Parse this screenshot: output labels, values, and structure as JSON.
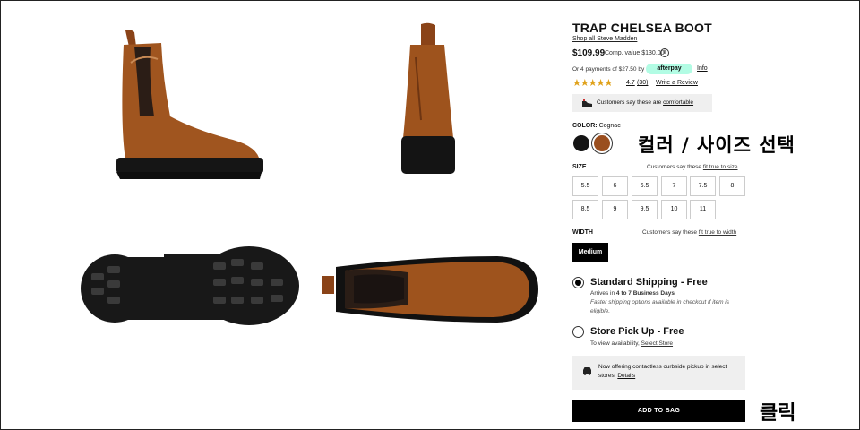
{
  "product": {
    "title": "TRAP CHELSEA BOOT",
    "shop_link": "Shop all Steve Madden",
    "price": "$109.99",
    "comp_value": "Comp. value $130.00",
    "payments_text": "Or 4 payments of $27.50 by",
    "afterpay_label": "afterpay",
    "info_link": "Info",
    "stars": "★★★★★",
    "rating": "4.7",
    "review_count": "(30)",
    "write_review": "Write a Review",
    "comfort_prefix": "Customers say these are ",
    "comfort_link": "comfortable"
  },
  "color": {
    "label": "COLOR:",
    "selected": "Cognac",
    "swatches": [
      {
        "name": "Black",
        "hex": "#141414"
      },
      {
        "name": "Cognac",
        "hex": "#9a4e1e"
      }
    ]
  },
  "size": {
    "label": "SIZE",
    "note_prefix": "Customers say these ",
    "note_link": "fit true to size",
    "options": [
      "5.5",
      "6",
      "6.5",
      "7",
      "7.5",
      "8",
      "8.5",
      "9",
      "9.5",
      "10",
      "11"
    ]
  },
  "width": {
    "label": "WIDTH",
    "note_prefix": "Customers say these ",
    "note_link": "fit true to width",
    "selected": "Medium"
  },
  "shipping": {
    "standard_title": "Standard Shipping - Free",
    "standard_sub_prefix": "Arrives in ",
    "standard_sub_bold": "4 to 7 Business Days",
    "standard_note": "Faster shipping options available in checkout if item is eligible.",
    "pickup_title": "Store Pick Up - Free",
    "pickup_sub_prefix": "To view availability, ",
    "pickup_link": "Select Store"
  },
  "curbside": {
    "text": "Now offering contactless curbside pickup in select stores. ",
    "link": "Details"
  },
  "cta": {
    "add_to_bag": "ADD TO BAG"
  },
  "annotations": {
    "color_size_caption": "컬러 / 사이즈 선택",
    "click_caption": "클릭"
  }
}
